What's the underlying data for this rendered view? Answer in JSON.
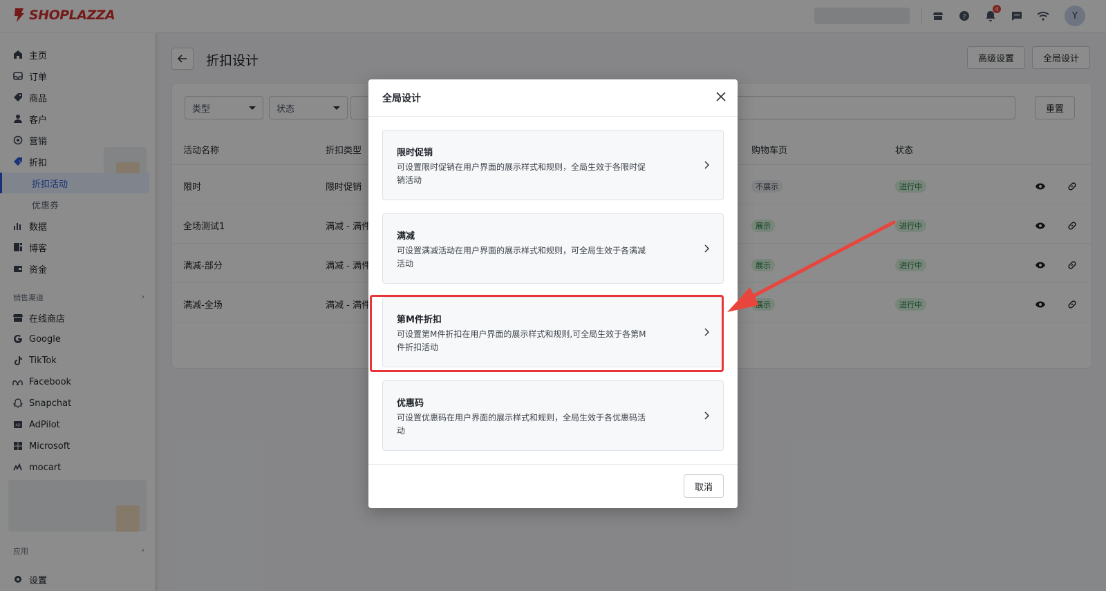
{
  "topbar": {
    "logo_text": "SHOPLAZZA",
    "notification_count": "4",
    "avatar_initial": "Y",
    "icons": [
      "store-icon",
      "help-icon",
      "bell-icon",
      "chat-icon",
      "wifi-icon"
    ]
  },
  "sidebar": {
    "items": [
      {
        "label": "主页",
        "icon": "home-icon"
      },
      {
        "label": "订单",
        "icon": "inbox-icon"
      },
      {
        "label": "商品",
        "icon": "tag-icon"
      },
      {
        "label": "客户",
        "icon": "user-icon"
      },
      {
        "label": "营销",
        "icon": "target-icon"
      },
      {
        "label": "折扣",
        "icon": "discount-icon"
      }
    ],
    "sub_items": [
      {
        "label": "折扣活动",
        "active": true
      },
      {
        "label": "优惠券",
        "active": false
      }
    ],
    "items2": [
      {
        "label": "数据",
        "icon": "bar-chart-icon"
      },
      {
        "label": "博客",
        "icon": "blog-icon"
      },
      {
        "label": "资金",
        "icon": "wallet-icon"
      }
    ],
    "sales_channel_label": "销售渠道",
    "channels": [
      {
        "label": "在线商店",
        "icon": "store-icon"
      },
      {
        "label": "Google",
        "icon": "google-icon"
      },
      {
        "label": "TikTok",
        "icon": "tiktok-icon"
      },
      {
        "label": "Facebook",
        "icon": "meta-icon"
      },
      {
        "label": "Snapchat",
        "icon": "snapchat-icon"
      },
      {
        "label": "AdPilot",
        "icon": "adpilot-icon"
      },
      {
        "label": "Microsoft",
        "icon": "microsoft-icon"
      },
      {
        "label": "mocart",
        "icon": "mocart-icon"
      }
    ],
    "apps_label": "应用",
    "settings_label": "设置"
  },
  "main": {
    "title": "折扣设计",
    "advanced_button": "高级设置",
    "global_button": "全局设计",
    "filters": {
      "type_label": "类型",
      "status_label": "状态",
      "reset_label": "重置"
    },
    "columns": [
      "活动名称",
      "折扣类型",
      "购物车页",
      "状态"
    ],
    "rows": [
      {
        "name": "限时",
        "type": "限时促销",
        "cart": "不展示",
        "status": "进行中"
      },
      {
        "name": "全场测试1",
        "type": "满减 - 满件",
        "cart": "展示",
        "status": "进行中"
      },
      {
        "name": "满减-部分",
        "type": "满减 - 满件",
        "cart": "展示",
        "status": "进行中"
      },
      {
        "name": "满减-全场",
        "type": "满减 - 满件",
        "cart": "展示",
        "status": "进行中"
      }
    ]
  },
  "modal": {
    "title": "全局设计",
    "options": [
      {
        "title": "限时促销",
        "desc": "可设置限时促销在用户界面的展示样式和规则，全局生效于各限时促销活动"
      },
      {
        "title": "满减",
        "desc": "可设置满减活动在用户界面的展示样式和规则，可全局生效于各满减活动"
      },
      {
        "title": "第M件折扣",
        "desc": "可设置第M件折扣在用户界面的展示样式和规则,可全局生效于各第M件折扣活动"
      },
      {
        "title": "优惠码",
        "desc": "可设置优惠码在用户界面的展示样式和规则，全局生效于各优惠码活动"
      }
    ],
    "cancel_label": "取消"
  },
  "colors": {
    "highlight": "#e8353a",
    "brand": "#d3312f",
    "active_nav": "#2d5bd7"
  }
}
